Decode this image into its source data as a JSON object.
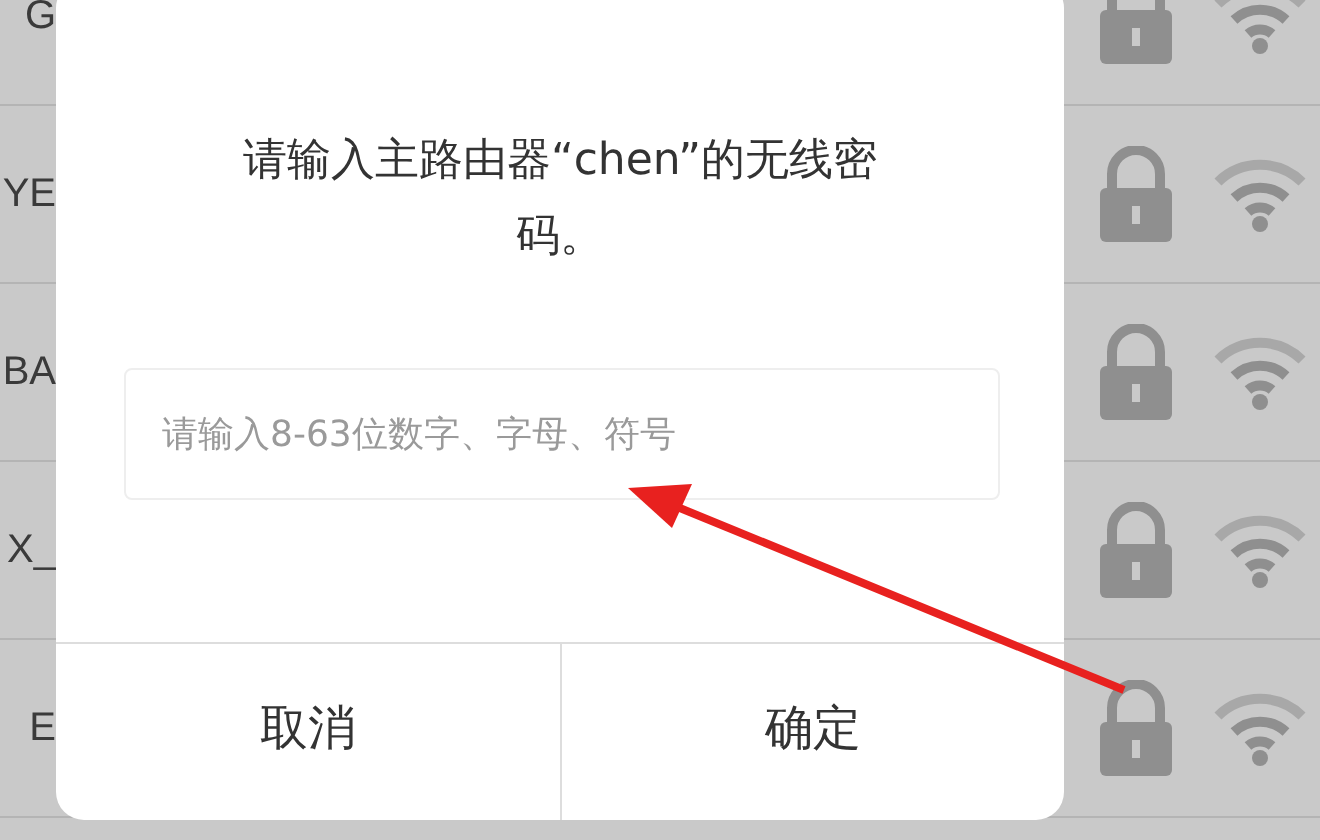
{
  "network_list": {
    "rows": [
      {
        "name": "G"
      },
      {
        "name": "YE"
      },
      {
        "name": "BA"
      },
      {
        "name": "X_"
      },
      {
        "name": "E"
      }
    ]
  },
  "dialog": {
    "message": "请输入主路由器“chen”的无线密码。",
    "password_field": {
      "placeholder": "请输入8-63位数字、字母、符号"
    },
    "buttons": [
      "取消",
      "确定"
    ]
  }
}
